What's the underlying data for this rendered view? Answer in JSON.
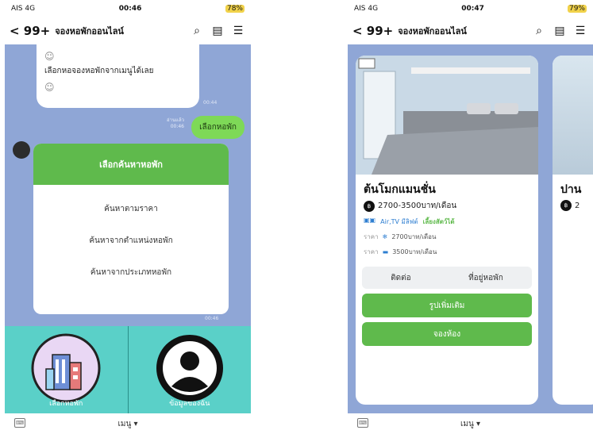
{
  "phoneA": {
    "status": {
      "carrier": "AIS 4G",
      "time": "00:46",
      "battery": "78%"
    },
    "header": {
      "back": "< 99+",
      "title": "จองหอพักออนไลน์"
    },
    "bubble_text": "เลือกหอจองหอพักจากเมนูได้เลย",
    "bubble_time": "00:44",
    "read_label": "อ่านแล้ว",
    "sent_time": "00:46",
    "sent_message": "เลือกหอพัก",
    "card": {
      "title": "เลือกค้นหาหอพัก",
      "items": [
        "ค้นหาตามราคา",
        "ค้นหาจากตำแหน่งหอพัก",
        "ค้นหาจากประเภทหอพัก"
      ]
    },
    "card_time": "00:46",
    "richmenu": {
      "left_label": "เลือกหอพัก",
      "right_label": "ข้อมูลของฉัน"
    },
    "bottom_menu": "เมนู ▾"
  },
  "phoneB": {
    "status": {
      "carrier": "AIS 4G",
      "time": "00:47",
      "battery": "79%"
    },
    "header": {
      "back": "< 99+",
      "title": "จองหอพักออนไลน์"
    },
    "room": {
      "title": "ต้นโมกแมนชั่น",
      "price": "2700-3500บาท/เดือน",
      "amenities": "Air,TV มีลิฟต์",
      "pet_note": "เลี้ยงสัตว์ได้",
      "rent_label": "ราคา",
      "rent1": "2700บาท/เดือน",
      "rent2": "3500บาท/เดือน",
      "contact": "ติดต่อ",
      "address": "ที่อยู่หอพัก",
      "more_photos": "รูปเพิ่มเติม",
      "book": "จองห้อง"
    },
    "room2_title": "ปาน",
    "room2_price": "2",
    "bottom_menu": "เมนู ▾"
  },
  "colors": {
    "chat_bg": "#8fa6d6",
    "green": "#5fba4c",
    "richmenu": "#5ad0c8"
  }
}
